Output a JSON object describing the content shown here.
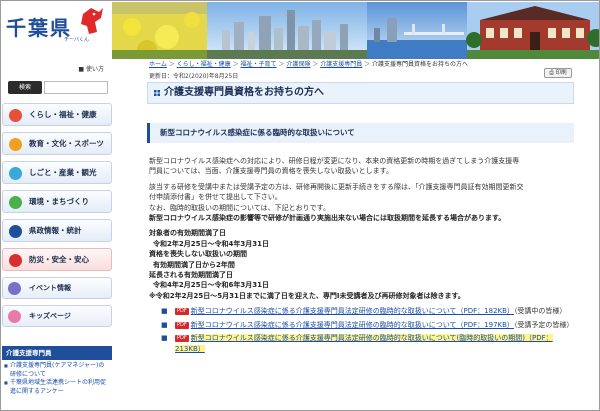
{
  "header": {
    "logo_text": "千葉県",
    "logo_sub": "チーバくん"
  },
  "sidebar": {
    "util_link": "使い方",
    "search_button": "検索",
    "search_placeholder": "",
    "nav": [
      {
        "label": "くらし・福祉・健康",
        "color": "#e8503a"
      },
      {
        "label": "教育・文化・スポーツ",
        "color": "#f0a020"
      },
      {
        "label": "しごと・産業・観光",
        "color": "#3aa8d8"
      },
      {
        "label": "環境・まちづくり",
        "color": "#4bb04b"
      },
      {
        "label": "県政情報・統計",
        "color": "#1f4e9a"
      },
      {
        "label": "防災・安全・安心",
        "color": "#d83030"
      }
    ],
    "small_nav": [
      {
        "label": "イベント情報",
        "color": "#7a6fc8"
      },
      {
        "label": "キッズページ",
        "color": "#e87aa8"
      }
    ],
    "section_heading": "介護支援専門員",
    "section_links": [
      "介護支援専門員(ケアマネジャー)の研修について",
      "千葉県地域生活連携シートの利用促進に関するアンケー"
    ]
  },
  "breadcrumb": {
    "items": [
      "ホーム",
      "くらし・福祉・健康",
      "福祉・子育て",
      "介護保険",
      "介護支援専門員"
    ],
    "current": "介護支援専門員資格をお持ちの方へ"
  },
  "updated": "更新日：令和2(2020)年8月25日",
  "print_label": "印刷",
  "page_title": "介護支援専門員資格をお持ちの方へ",
  "section_title": "新型コロナウイルス感染症に係る臨時的な取扱いについて",
  "content": {
    "para1a": "新型コロナウイルス感染症への対応により、研修日程が変更になり、本来の資格更新の時期を過ぎてしまう介護支援専",
    "para1b": "門員については、当面、介護支援専門員の資格を喪失しない取扱いとします。",
    "para2a": "該当する研修を受講中または受講予定の方は、研修再開後に更新手続きをする際は、「介護支援専門員証有効期間更新交",
    "para2b": "付申請添付書」を併せて提出して下さい。",
    "para2c": "なお、臨時的取扱いの期間については、下記とおりです。",
    "para2d": "新型コロナウイルス感染症の影響等で研修が計画通り実施出来ない場合には取扱期間を延長する場合があります。",
    "term1_label": "対象者の有効期間満了日",
    "term1_value": "令和2年2月25日～令和4年3月31日",
    "term2_label": "資格を喪失しない取扱いの期間",
    "term2_value": "有効期間満了日から2年間",
    "term3_label": "延長される有効期間満了日",
    "term3_value": "令和4年2月25日～令和6年3月31日",
    "note": "※令和2年2月25日～5月31日までに満了日を迎えた、専門I未受講者及び再研修対象者は除きます。",
    "pdf_label": "PDF",
    "links": [
      {
        "text": "新型コロナウイルス感染症に係る介護支援専門員法定研修の臨時的な取扱いについて（PDF：182KB）",
        "suffix": "（受講中の皆様）"
      },
      {
        "text": "新型コロナウイルス感染症に係る介護支援専門員法定研修の臨時的な取扱いについて（PDF：197KB）",
        "suffix": "（受講予定の皆様）"
      },
      {
        "text": "新型コロナウイルス感染症に係る介護支援専門員法定研修の臨時的な取扱いについて(臨時的取扱いの期間)（PDF：213KB）",
        "suffix": ""
      }
    ]
  }
}
